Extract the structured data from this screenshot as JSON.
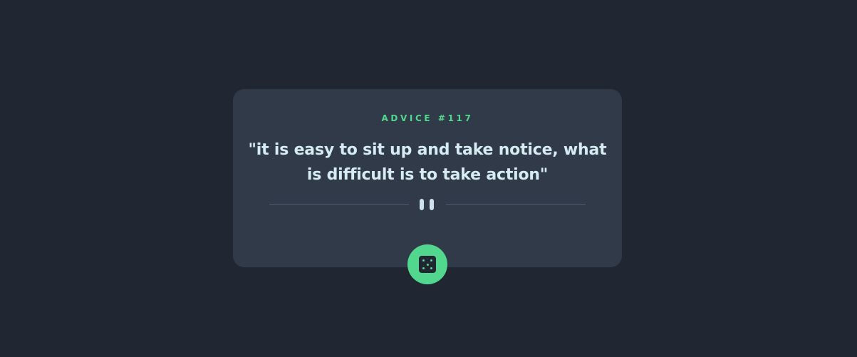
{
  "card": {
    "advice_id": "ADVICE #117",
    "quote": "\"it is easy to sit up and take notice, what is difficult is to take action\""
  },
  "divider": {
    "icon": "pause-icon"
  },
  "button": {
    "icon": "dice-icon"
  },
  "colors": {
    "background": "#202632",
    "card": "#313a48",
    "accent": "#52d88e",
    "text": "#d6ecf2",
    "divider": "#4f5d74"
  }
}
